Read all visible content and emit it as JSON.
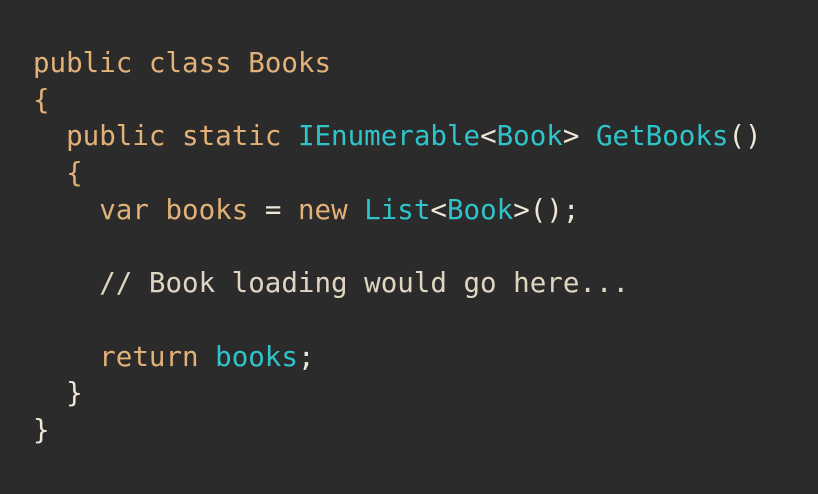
{
  "colors": {
    "background": "#2b2b2b",
    "keyword": "#e3b178",
    "type": "#2ec4c9",
    "punctuation": "#f0e6d8",
    "comment": "#e0d5c2"
  },
  "code": {
    "line1": {
      "kw1": "public",
      "kw2": "class",
      "name": "Books"
    },
    "line2": {
      "brace": "{"
    },
    "line3": {
      "kw1": "public",
      "kw2": "static",
      "type": "IEnumerable",
      "lt": "<",
      "generic": "Book",
      "gt": ">",
      "method": "GetBooks",
      "parens": "()"
    },
    "line4": {
      "brace": "{"
    },
    "line5": {
      "kw": "var",
      "ident": "books",
      "eq": "=",
      "kwnew": "new",
      "type": "List",
      "lt": "<",
      "generic": "Book",
      "gt": ">",
      "tail": "();"
    },
    "line7": {
      "comment": "// Book loading would go here..."
    },
    "line9": {
      "kw": "return",
      "ident": "books",
      "semi": ";"
    },
    "line10": {
      "brace": "}"
    },
    "line11": {
      "brace": "}"
    }
  }
}
